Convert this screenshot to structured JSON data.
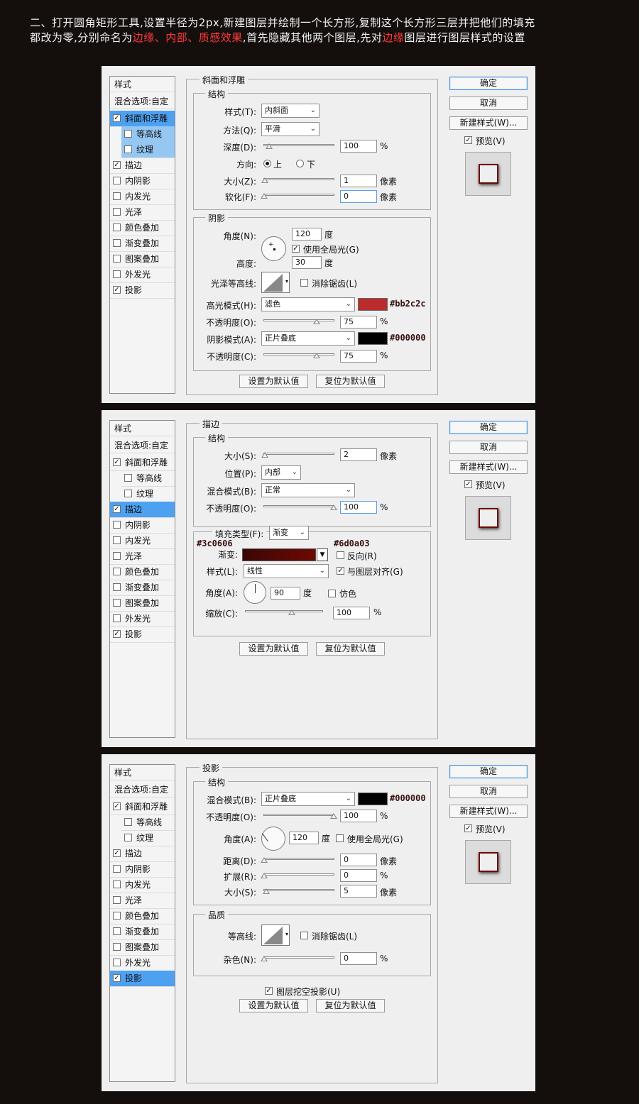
{
  "intro": {
    "line1": "二、打开圆角矩形工具,设置半径为2px,新建图层并绘制一个长方形,复制这个长方形三层并把他们的填充",
    "line2_prefix": "都改为零,分别命名为",
    "line2_hl1": "边缘、内部、质感效果",
    "line2_mid": ",首先隐藏其他两个图层,先对",
    "line2_hl2": "边缘",
    "line2_suffix": "图层进行图层样式的设置"
  },
  "common": {
    "styles_header": "样式",
    "blend_options": "混合选项:自定",
    "items": [
      "斜面和浮雕",
      "等高线",
      "纹理",
      "描边",
      "内阴影",
      "内发光",
      "光泽",
      "颜色叠加",
      "渐变叠加",
      "图案叠加",
      "外发光",
      "投影"
    ],
    "ok": "确定",
    "cancel": "取消",
    "new_style": "新建样式(W)...",
    "preview": "预览(V)",
    "set_default": "设置为默认值",
    "reset_default": "复位为默认值",
    "structure": "结构",
    "pixels": "像素",
    "percent": "%",
    "degree": "度"
  },
  "bevel": {
    "title": "斜面和浮雕",
    "style_label": "样式(T):",
    "style_value": "内斜面",
    "technique_label": "方法(Q):",
    "technique_value": "平滑",
    "depth_label": "深度(D):",
    "depth_value": "100",
    "depth_level": 0.07,
    "direction_label": "方向:",
    "dir_up": "上",
    "dir_down": "下",
    "size_label": "大小(Z):",
    "size_value": "1",
    "size_level": 0.01,
    "soften_label": "软化(F):",
    "soften_value": "0",
    "soften_level": 0.0,
    "shading": "阴影",
    "angle_label": "角度(N):",
    "angle_value": "120",
    "global_light": "使用全局光(G)",
    "altitude_label": "高度:",
    "altitude_value": "30",
    "gloss_label": "光泽等高线:",
    "anti_alias": "消除锯齿(L)",
    "highlight_label": "高光模式(H):",
    "highlight_value": "滤色",
    "highlight_color": "#bb2c2c",
    "hl_opacity_label": "不透明度(O):",
    "hl_opacity_value": "75",
    "hl_opacity_level": 0.75,
    "shadow_label": "阴影模式(A):",
    "shadow_value": "正片叠底",
    "shadow_color": "#000000",
    "sh_opacity_label": "不透明度(C):",
    "sh_opacity_value": "75",
    "sh_opacity_level": 0.75,
    "checked": [
      true,
      false,
      false,
      true,
      false,
      false,
      false,
      false,
      false,
      false,
      false,
      true
    ]
  },
  "stroke": {
    "title": "描边",
    "size_label": "大小(S):",
    "size_value": "2",
    "size_level": 0.01,
    "position_label": "位置(P):",
    "position_value": "内部",
    "blend_label": "混合模式(B):",
    "blend_value": "正常",
    "opacity_label": "不透明度(O):",
    "opacity_value": "100",
    "opacity_level": 1.0,
    "fill_type_label": "填充类型(F):",
    "fill_type_value": "渐变",
    "color_left": "#3c0606",
    "color_right": "#6d0a03",
    "gradient_label": "渐变:",
    "reverse": "反向(R)",
    "style_label": "样式(L):",
    "style_value": "线性",
    "align": "与图层对齐(G)",
    "angle_label": "角度(A):",
    "angle_value": "90",
    "dither": "仿色",
    "scale_label": "缩放(C):",
    "scale_value": "100",
    "scale_level": 0.6,
    "checked": [
      true,
      false,
      false,
      true,
      false,
      false,
      false,
      false,
      false,
      false,
      false,
      true
    ]
  },
  "shadow": {
    "title": "投影",
    "blend_label": "混合模式(B):",
    "blend_value": "正片叠底",
    "blend_color": "#000000",
    "opacity_label": "不透明度(O):",
    "opacity_value": "100",
    "opacity_level": 1.0,
    "angle_label": "角度(A):",
    "angle_value": "120",
    "global_light": "使用全局光(G)",
    "distance_label": "距离(D):",
    "distance_value": "0",
    "distance_level": 0.0,
    "spread_label": "扩展(R):",
    "spread_value": "0",
    "spread_level": 0.0,
    "size_label": "大小(S):",
    "size_value": "5",
    "size_level": 0.03,
    "quality": "品质",
    "contour_label": "等高线:",
    "anti_alias": "消除锯齿(L)",
    "noise_label": "杂色(N):",
    "noise_value": "0",
    "noise_level": 0.0,
    "knockout": "图层挖空投影(U)",
    "checked": [
      true,
      false,
      false,
      true,
      false,
      false,
      false,
      false,
      false,
      false,
      false,
      true
    ]
  }
}
